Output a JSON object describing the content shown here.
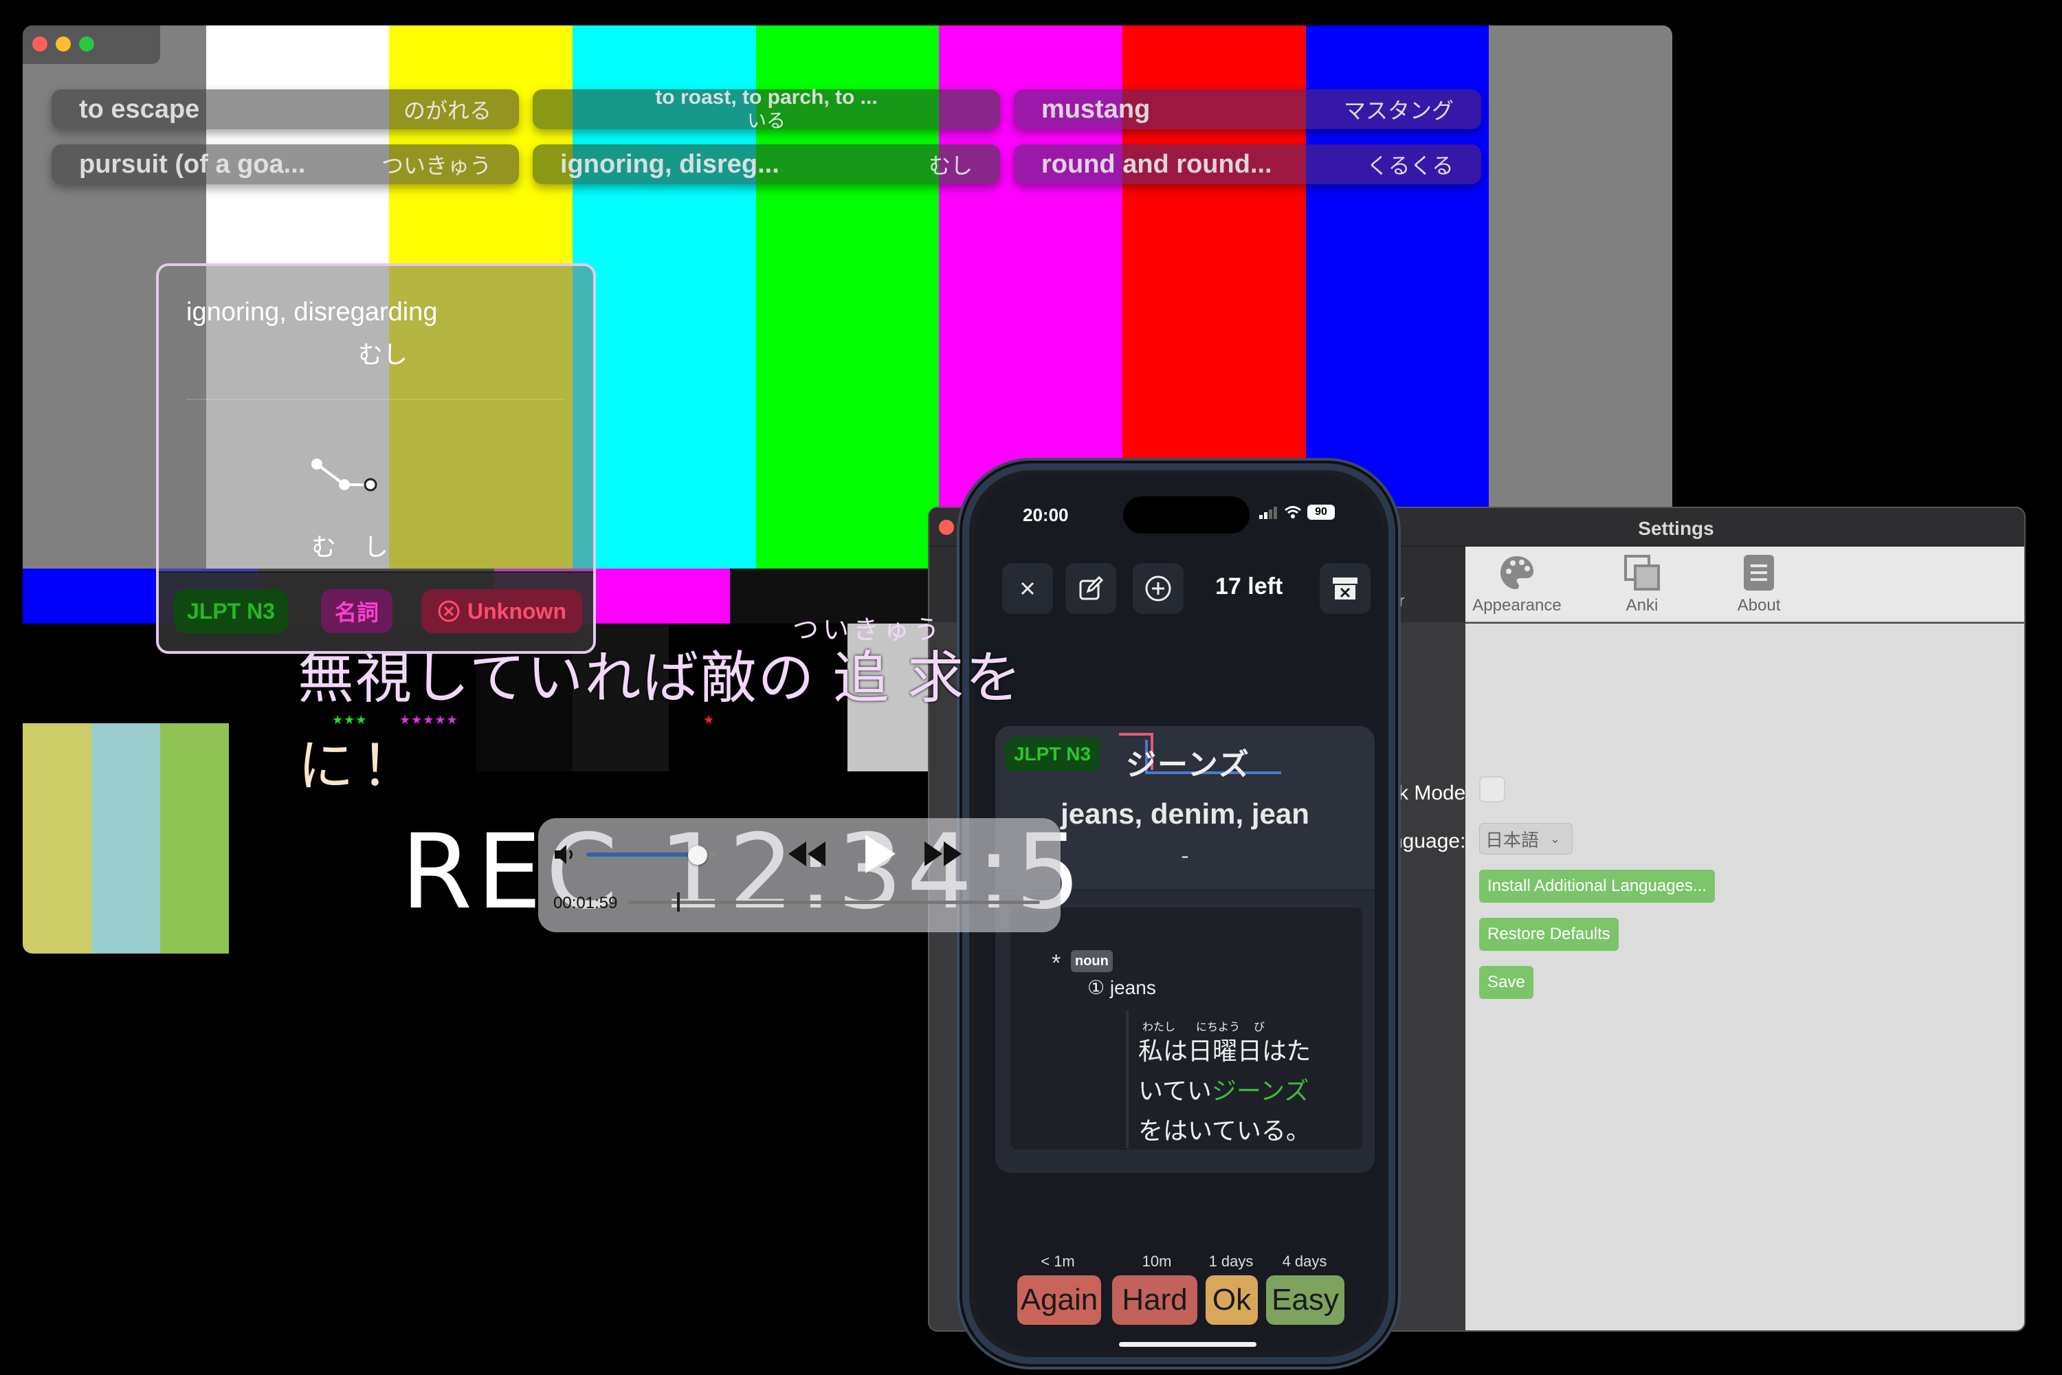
{
  "video": {
    "bar_colors_top": [
      "#808080",
      "#ffffff",
      "#ffff00",
      "#00ffff",
      "#00ff00",
      "#ff00ff",
      "#ff0000",
      "#0000ff",
      "#808080"
    ],
    "bar_colors_mid": [
      "#0000ff",
      "#101010",
      "#ff00ff",
      "#101010",
      "#00ffff",
      "#101010",
      "#c0c0c0"
    ],
    "pluge_colors": [
      "#cccc66",
      "#99cccc",
      "#8fc455"
    ],
    "chips": [
      {
        "en": "to escape",
        "jp": "のがれる"
      },
      {
        "en": "to roast, to parch, to ...",
        "jp": "いる"
      },
      {
        "en": "mustang",
        "jp": "マスタング"
      },
      {
        "en": "pursuit (of a goa...",
        "jp": "ついきゅう"
      },
      {
        "en": "ignoring, disreg...",
        "jp": "むし"
      },
      {
        "en": "round and round...",
        "jp": "くるくる"
      }
    ],
    "popup": {
      "gloss": "ignoring, disregarding",
      "reading": "むし",
      "pitch_kana_1": "む",
      "pitch_kana_2": "し",
      "tags": {
        "jlpt": "JLPT N3",
        "pos": "名詞",
        "status": "Unknown"
      }
    },
    "subtitle": {
      "line1": "無視していれば敵の 追 求を",
      "furigana": "ついきゅう",
      "line2": "に！",
      "stars_green": "★★★",
      "stars_magenta": "★★★★★",
      "stars_red": "★"
    },
    "rec_text": "REC 12:34:5",
    "player": {
      "elapsed": "00:01:59",
      "progress": 0.12,
      "volume": 0.85
    }
  },
  "settings": {
    "title": "Settings",
    "toolbar": [
      {
        "label": "ur",
        "icon": "general-icon"
      },
      {
        "label": "Appearance",
        "icon": "palette-icon"
      },
      {
        "label": "Anki",
        "icon": "anki-icon"
      },
      {
        "label": "About",
        "icon": "about-icon"
      }
    ],
    "dark_mode_label": "rk Mode",
    "language_label": "nguage:",
    "language_value": "日本語",
    "buttons": {
      "install_languages": "Install Additional Languages...",
      "restore_defaults": "Restore Defaults",
      "save": "Save"
    }
  },
  "phone": {
    "status": {
      "time": "20:00",
      "battery": "90"
    },
    "count_left": "17 left",
    "card": {
      "jlpt": "JLPT N3",
      "word": "ジーンズ",
      "meaning": "jeans, denim, jean",
      "reading_dash": "-",
      "pos_tag": "noun",
      "sense_marker": "*",
      "sense": "① jeans",
      "example_ruby": [
        "わたし",
        "にちよう",
        "び"
      ],
      "example_line1": "私は日曜日はた",
      "example_line2_pre": "いてい",
      "example_highlight": "ジーンズ",
      "example_line3": "をはいている。"
    },
    "grades": [
      {
        "label": "Again",
        "interval": "< 1m",
        "color": "#c9645a"
      },
      {
        "label": "Hard",
        "interval": "10m",
        "color": "#c2625a"
      },
      {
        "label": "Ok",
        "interval": "1 days",
        "color": "#d9a75a"
      },
      {
        "label": "Easy",
        "interval": "4 days",
        "color": "#7da25e"
      }
    ]
  }
}
